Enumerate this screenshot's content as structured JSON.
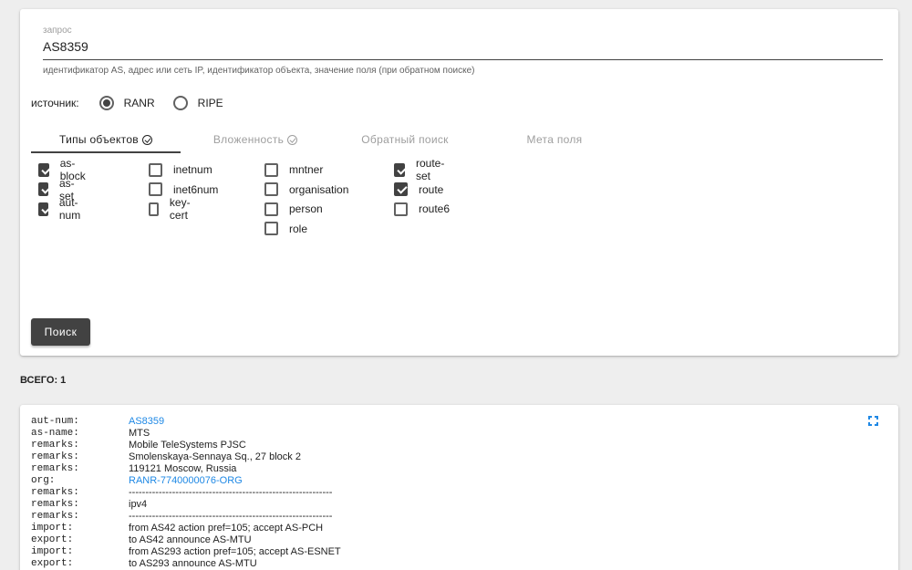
{
  "search": {
    "label": "запрос",
    "value": "AS8359",
    "hint": "идентификатор AS, адрес или сеть IP, идентификатор объекта, значение поля (при обратном поиске)"
  },
  "source": {
    "label": "источник:",
    "options": [
      {
        "label": "RANR",
        "checked": true
      },
      {
        "label": "RIPE",
        "checked": false
      }
    ]
  },
  "tabs": [
    {
      "label": "Типы объектов",
      "active": true,
      "icon": "check-circle-icon"
    },
    {
      "label": "Вложенность",
      "active": false,
      "icon": "check-circle-icon"
    },
    {
      "label": "Обратный поиск",
      "active": false
    },
    {
      "label": "Мета поля",
      "active": false
    }
  ],
  "object_types": [
    {
      "label": "as-block",
      "checked": true
    },
    {
      "label": "as-set",
      "checked": true
    },
    {
      "label": "aut-num",
      "checked": true
    },
    {
      "label": "inetnum",
      "checked": false
    },
    {
      "label": "inet6num",
      "checked": false
    },
    {
      "label": "key-cert",
      "checked": false
    },
    {
      "label": "mntner",
      "checked": false
    },
    {
      "label": "organisation",
      "checked": false
    },
    {
      "label": "person",
      "checked": false
    },
    {
      "label": "role",
      "checked": false
    },
    {
      "label": "route-set",
      "checked": true
    },
    {
      "label": "route",
      "checked": true
    },
    {
      "label": "route6",
      "checked": false
    }
  ],
  "search_button": "Поиск",
  "total": "ВСЕГО: 1",
  "result": {
    "expand_icon": "fullscreen-icon",
    "rows": [
      {
        "key": "aut-num:",
        "value": "AS8359",
        "link": true
      },
      {
        "key": "as-name:",
        "value": "MTS",
        "link": false
      },
      {
        "key": "remarks:",
        "value": "Mobile TeleSystems PJSC",
        "link": false
      },
      {
        "key": "remarks:",
        "value": "Smolenskaya-Sennaya Sq., 27 block 2",
        "link": false
      },
      {
        "key": "remarks:",
        "value": "119121 Moscow, Russia",
        "link": false
      },
      {
        "key": "org:",
        "value": "RANR-7740000076-ORG",
        "link": true
      },
      {
        "key": "remarks:",
        "value": "-------------------------------------------------------------",
        "link": false
      },
      {
        "key": "remarks:",
        "value": "ipv4",
        "link": false
      },
      {
        "key": "remarks:",
        "value": "-------------------------------------------------------------",
        "link": false
      },
      {
        "key": "import:",
        "value": "from AS42 action pref=105; accept AS-PCH",
        "link": false
      },
      {
        "key": "export:",
        "value": "to AS42 announce AS-MTU",
        "link": false
      },
      {
        "key": "import:",
        "value": "from AS293 action pref=105; accept AS-ESNET",
        "link": false
      },
      {
        "key": "export:",
        "value": "to AS293 announce AS-MTU",
        "link": false
      }
    ]
  }
}
